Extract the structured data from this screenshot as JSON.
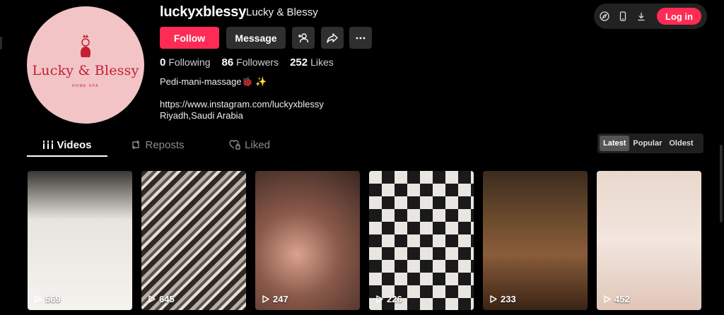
{
  "profile": {
    "username": "luckyxblessy",
    "display_name": "Lucky & Blessy",
    "avatar_text": "Lucky & Blessy",
    "avatar_subtext": "HOME SPA",
    "bio": "Pedi-mani-massage🐞 ✨",
    "link": "https://www.instagram.com/luckyxblessy",
    "location": "Riyadh,Saudi Arabia"
  },
  "actions": {
    "follow": "Follow",
    "message": "Message"
  },
  "stats": {
    "following_count": "0",
    "following_label": "Following",
    "followers_count": "86",
    "followers_label": "Followers",
    "likes_count": "252",
    "likes_label": "Likes"
  },
  "tabs": {
    "videos": "Videos",
    "reposts": "Reposts",
    "liked": "Liked"
  },
  "sort": {
    "latest": "Latest",
    "popular": "Popular",
    "oldest": "Oldest"
  },
  "topbar": {
    "login": "Log in"
  },
  "videos": [
    {
      "views": "569"
    },
    {
      "views": "645"
    },
    {
      "views": "247"
    },
    {
      "views": "226"
    },
    {
      "views": "233"
    },
    {
      "views": "452"
    }
  ],
  "colors": {
    "accent": "#fe2c55",
    "secondary_button": "#2f2f2f",
    "avatar_bg": "#f2c4c6",
    "avatar_text": "#c41e34"
  }
}
